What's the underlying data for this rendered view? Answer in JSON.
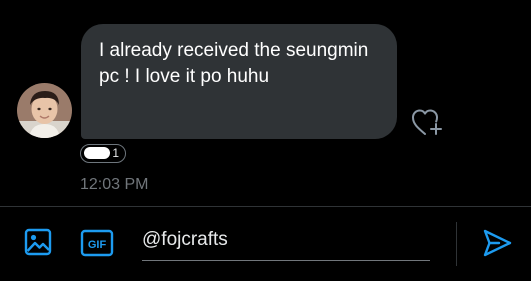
{
  "message": {
    "text": "I already received the seungmin pc ! I love it po huhu",
    "timestamp": "12:03 PM",
    "reaction_count": "1"
  },
  "composer": {
    "value": "@fojcrafts",
    "icons": {
      "image": "image-icon",
      "gif": "gif-icon",
      "send": "send-icon",
      "react": "add-reaction-heart-icon"
    },
    "gif_label": "GIF"
  },
  "colors": {
    "background": "#000000",
    "bubble": "#2f3336",
    "accent": "#1d9bf0",
    "muted": "#71767b",
    "divider": "#2f3336"
  }
}
